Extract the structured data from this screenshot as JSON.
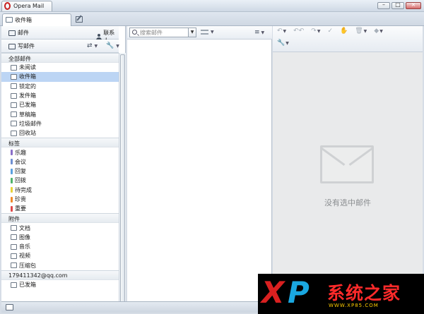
{
  "window": {
    "title": "Opera Mail",
    "controls": [
      "minimize",
      "maximize",
      "close"
    ]
  },
  "tabs": {
    "inbox_label": "收件箱"
  },
  "sidebar": {
    "toolbar": {
      "mail_label": "邮件",
      "contacts_label": "联系人",
      "compose_label": "写邮件"
    },
    "sections": {
      "all_mail": {
        "title": "全部邮件",
        "items": [
          {
            "label": "未阅读",
            "icon": "envelope-icon"
          },
          {
            "label": "收件箱",
            "icon": "inbox-icon",
            "selected": true
          },
          {
            "label": "锁定的",
            "icon": "pin-icon"
          },
          {
            "label": "发件箱",
            "icon": "outbox-icon"
          },
          {
            "label": "已发箱",
            "icon": "sent-icon"
          },
          {
            "label": "草稿箱",
            "icon": "pencil-icon"
          },
          {
            "label": "垃圾邮件",
            "icon": "hand-icon"
          },
          {
            "label": "回收站",
            "icon": "trash-icon"
          }
        ]
      },
      "labels": {
        "title": "标签",
        "items": [
          {
            "label": "乐趣",
            "color": "#8a6fc9"
          },
          {
            "label": "会议",
            "color": "#6f8fd1"
          },
          {
            "label": "回复",
            "color": "#5aa0e0"
          },
          {
            "label": "回拨",
            "color": "#4fb36a"
          },
          {
            "label": "待完成",
            "color": "#e8d23a"
          },
          {
            "label": "珍贵",
            "color": "#f08a2a"
          },
          {
            "label": "重要",
            "color": "#e04848"
          }
        ]
      },
      "attachments": {
        "title": "附件",
        "items": [
          {
            "label": "文档",
            "icon": "document-icon"
          },
          {
            "label": "图像",
            "icon": "image-icon"
          },
          {
            "label": "音乐",
            "icon": "music-icon"
          },
          {
            "label": "视频",
            "icon": "video-icon"
          },
          {
            "label": "压缩包",
            "icon": "archive-icon"
          }
        ]
      },
      "account": {
        "title": "179411342@qq.com",
        "items": [
          {
            "label": "已发箱",
            "icon": "sent-icon"
          }
        ]
      }
    }
  },
  "list": {
    "search_placeholder": "搜索邮件"
  },
  "preview": {
    "empty_text": "没有选中邮件"
  },
  "watermark": {
    "x": "X",
    "p": "P",
    "text": "系统之家",
    "sub": "WWW.XP85.COM"
  }
}
